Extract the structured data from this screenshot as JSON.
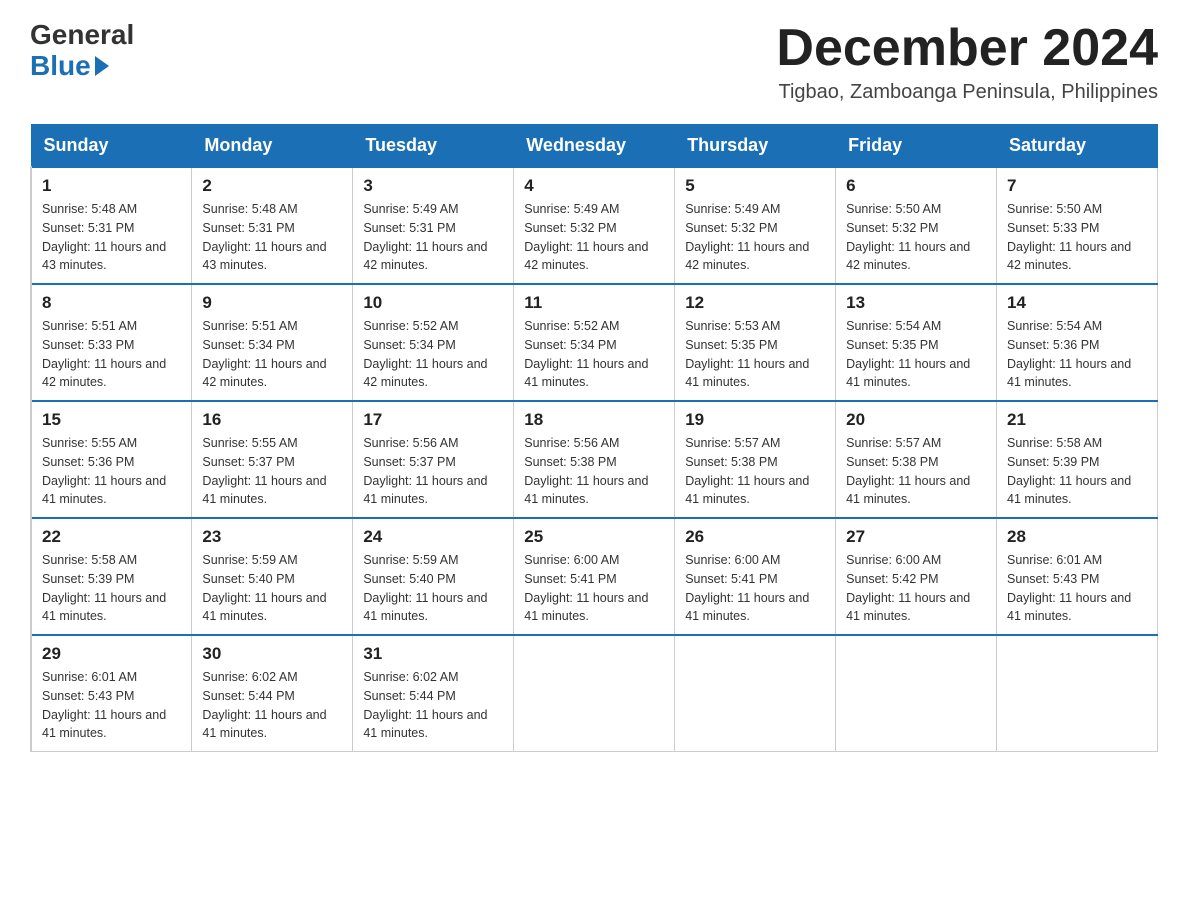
{
  "logo": {
    "general": "General",
    "blue": "Blue"
  },
  "title": "December 2024",
  "location": "Tigbao, Zamboanga Peninsula, Philippines",
  "headers": [
    "Sunday",
    "Monday",
    "Tuesday",
    "Wednesday",
    "Thursday",
    "Friday",
    "Saturday"
  ],
  "weeks": [
    [
      {
        "day": "1",
        "sunrise": "5:48 AM",
        "sunset": "5:31 PM",
        "daylight": "11 hours and 43 minutes."
      },
      {
        "day": "2",
        "sunrise": "5:48 AM",
        "sunset": "5:31 PM",
        "daylight": "11 hours and 43 minutes."
      },
      {
        "day": "3",
        "sunrise": "5:49 AM",
        "sunset": "5:31 PM",
        "daylight": "11 hours and 42 minutes."
      },
      {
        "day": "4",
        "sunrise": "5:49 AM",
        "sunset": "5:32 PM",
        "daylight": "11 hours and 42 minutes."
      },
      {
        "day": "5",
        "sunrise": "5:49 AM",
        "sunset": "5:32 PM",
        "daylight": "11 hours and 42 minutes."
      },
      {
        "day": "6",
        "sunrise": "5:50 AM",
        "sunset": "5:32 PM",
        "daylight": "11 hours and 42 minutes."
      },
      {
        "day": "7",
        "sunrise": "5:50 AM",
        "sunset": "5:33 PM",
        "daylight": "11 hours and 42 minutes."
      }
    ],
    [
      {
        "day": "8",
        "sunrise": "5:51 AM",
        "sunset": "5:33 PM",
        "daylight": "11 hours and 42 minutes."
      },
      {
        "day": "9",
        "sunrise": "5:51 AM",
        "sunset": "5:34 PM",
        "daylight": "11 hours and 42 minutes."
      },
      {
        "day": "10",
        "sunrise": "5:52 AM",
        "sunset": "5:34 PM",
        "daylight": "11 hours and 42 minutes."
      },
      {
        "day": "11",
        "sunrise": "5:52 AM",
        "sunset": "5:34 PM",
        "daylight": "11 hours and 41 minutes."
      },
      {
        "day": "12",
        "sunrise": "5:53 AM",
        "sunset": "5:35 PM",
        "daylight": "11 hours and 41 minutes."
      },
      {
        "day": "13",
        "sunrise": "5:54 AM",
        "sunset": "5:35 PM",
        "daylight": "11 hours and 41 minutes."
      },
      {
        "day": "14",
        "sunrise": "5:54 AM",
        "sunset": "5:36 PM",
        "daylight": "11 hours and 41 minutes."
      }
    ],
    [
      {
        "day": "15",
        "sunrise": "5:55 AM",
        "sunset": "5:36 PM",
        "daylight": "11 hours and 41 minutes."
      },
      {
        "day": "16",
        "sunrise": "5:55 AM",
        "sunset": "5:37 PM",
        "daylight": "11 hours and 41 minutes."
      },
      {
        "day": "17",
        "sunrise": "5:56 AM",
        "sunset": "5:37 PM",
        "daylight": "11 hours and 41 minutes."
      },
      {
        "day": "18",
        "sunrise": "5:56 AM",
        "sunset": "5:38 PM",
        "daylight": "11 hours and 41 minutes."
      },
      {
        "day": "19",
        "sunrise": "5:57 AM",
        "sunset": "5:38 PM",
        "daylight": "11 hours and 41 minutes."
      },
      {
        "day": "20",
        "sunrise": "5:57 AM",
        "sunset": "5:38 PM",
        "daylight": "11 hours and 41 minutes."
      },
      {
        "day": "21",
        "sunrise": "5:58 AM",
        "sunset": "5:39 PM",
        "daylight": "11 hours and 41 minutes."
      }
    ],
    [
      {
        "day": "22",
        "sunrise": "5:58 AM",
        "sunset": "5:39 PM",
        "daylight": "11 hours and 41 minutes."
      },
      {
        "day": "23",
        "sunrise": "5:59 AM",
        "sunset": "5:40 PM",
        "daylight": "11 hours and 41 minutes."
      },
      {
        "day": "24",
        "sunrise": "5:59 AM",
        "sunset": "5:40 PM",
        "daylight": "11 hours and 41 minutes."
      },
      {
        "day": "25",
        "sunrise": "6:00 AM",
        "sunset": "5:41 PM",
        "daylight": "11 hours and 41 minutes."
      },
      {
        "day": "26",
        "sunrise": "6:00 AM",
        "sunset": "5:41 PM",
        "daylight": "11 hours and 41 minutes."
      },
      {
        "day": "27",
        "sunrise": "6:00 AM",
        "sunset": "5:42 PM",
        "daylight": "11 hours and 41 minutes."
      },
      {
        "day": "28",
        "sunrise": "6:01 AM",
        "sunset": "5:43 PM",
        "daylight": "11 hours and 41 minutes."
      }
    ],
    [
      {
        "day": "29",
        "sunrise": "6:01 AM",
        "sunset": "5:43 PM",
        "daylight": "11 hours and 41 minutes."
      },
      {
        "day": "30",
        "sunrise": "6:02 AM",
        "sunset": "5:44 PM",
        "daylight": "11 hours and 41 minutes."
      },
      {
        "day": "31",
        "sunrise": "6:02 AM",
        "sunset": "5:44 PM",
        "daylight": "11 hours and 41 minutes."
      },
      null,
      null,
      null,
      null
    ]
  ]
}
